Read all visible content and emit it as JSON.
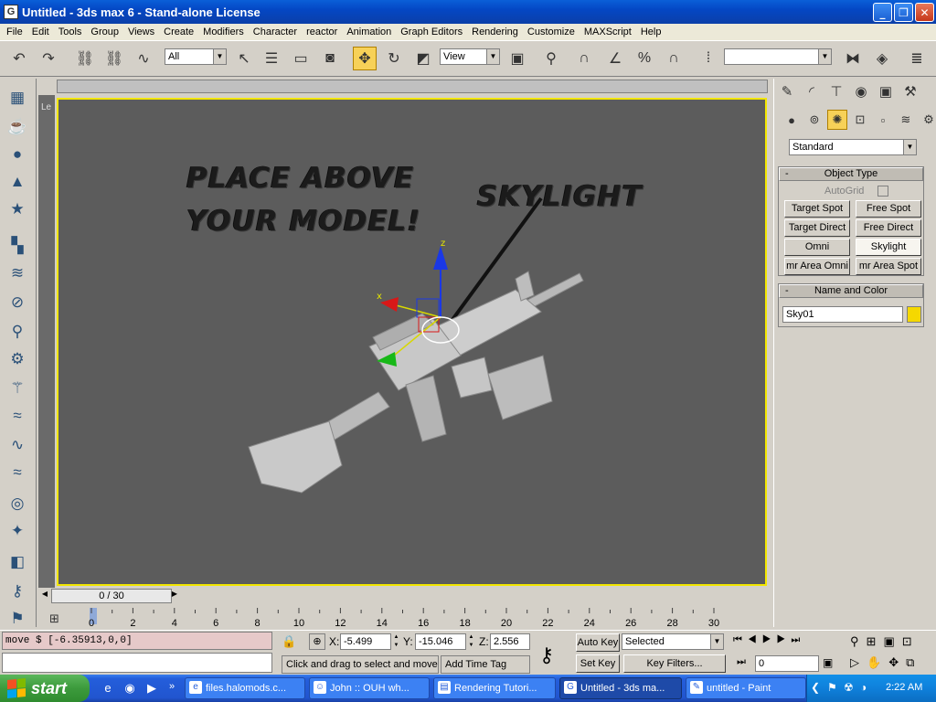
{
  "window": {
    "title": "Untitled - 3ds max 6 - Stand-alone License",
    "app_icon": "G"
  },
  "menu": [
    "File",
    "Edit",
    "Tools",
    "Group",
    "Views",
    "Create",
    "Modifiers",
    "Character",
    "reactor",
    "Animation",
    "Graph Editors",
    "Rendering",
    "Customize",
    "MAXScript",
    "Help"
  ],
  "toolbar": {
    "selection_filter": "All",
    "reference_coord": "View",
    "named_selection": ""
  },
  "viewport": {
    "label": "Le",
    "annotation_line1": "PLACE ABOVE",
    "annotation_line2": "YOUR MODEL!",
    "annotation_skylight": "SKYLIGHT",
    "axis_x": "x",
    "axis_z": "z",
    "accent_color": "#f2e600"
  },
  "timeslider": {
    "frame": "0 / 30",
    "ticks": [
      "0",
      "2",
      "4",
      "6",
      "8",
      "10",
      "12",
      "14",
      "16",
      "18",
      "20",
      "22",
      "24",
      "26",
      "28",
      "30"
    ]
  },
  "command_panel": {
    "object_category": "Standard",
    "object_type": {
      "title": "Object Type",
      "autogrid_label": "AutoGrid",
      "buttons": [
        "Target Spot",
        "Free Spot",
        "Target Direct",
        "Free Direct",
        "Omni",
        "Skylight",
        "mr Area Omni",
        "mr Area Spot"
      ]
    },
    "name_and_color": {
      "title": "Name and Color",
      "name_value": "Sky01",
      "color": "#f5d800"
    }
  },
  "status": {
    "listener_text": "move $ [-6.35913,0,0]",
    "coords": {
      "x_label": "X:",
      "x": "-5.499",
      "y_label": "Y:",
      "y": "-15.046",
      "z_label": "Z:",
      "z": "2.556"
    },
    "prompt": "Click and drag to select and move",
    "add_time_tag": "Add Time Tag",
    "auto_key": "Auto Key",
    "set_key": "Set Key",
    "key_mode": "Selected",
    "key_filters": "Key Filters...",
    "current_frame": "0"
  },
  "taskbar": {
    "start": "start",
    "tasks": [
      "files.halomods.c...",
      "John :: OUH wh...",
      "Rendering Tutori...",
      "Untitled - 3ds ma...",
      "untitled - Paint"
    ],
    "clock": "2:22 AM",
    "overflow": "»"
  }
}
